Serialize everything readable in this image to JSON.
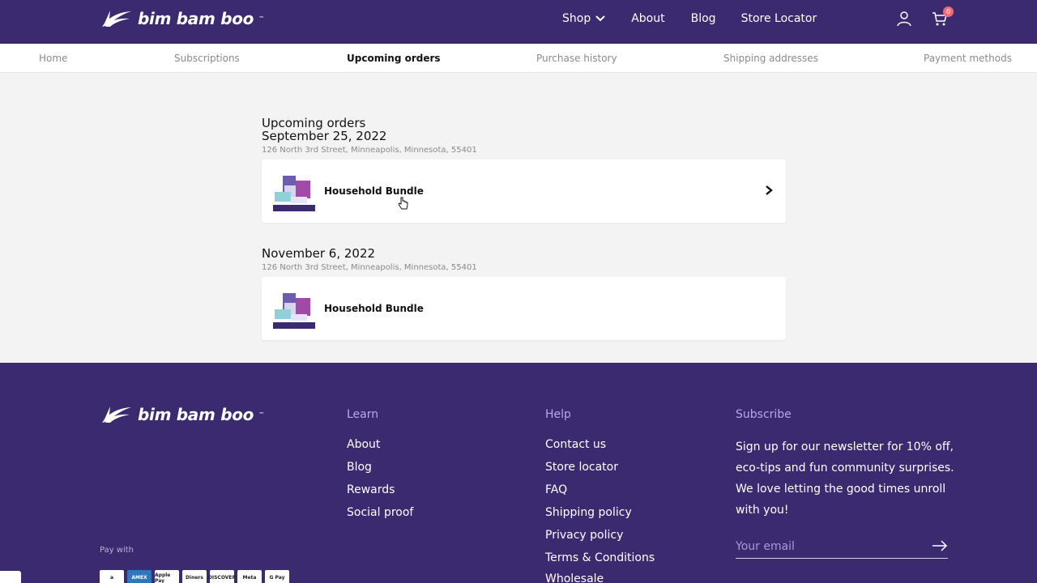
{
  "brand": {
    "name": "bim bam boo",
    "trademark": "™"
  },
  "header": {
    "nav": [
      {
        "label": "Shop",
        "has_dropdown": true
      },
      {
        "label": "About"
      },
      {
        "label": "Blog"
      },
      {
        "label": "Store Locator"
      }
    ],
    "cart_count": "0"
  },
  "subnav": {
    "items": [
      "Home",
      "Subscriptions",
      "Upcoming orders",
      "Purchase history",
      "Shipping addresses",
      "Payment methods"
    ],
    "active": "Upcoming orders"
  },
  "main": {
    "title": "Upcoming orders",
    "orders": [
      {
        "date": "September 25, 2022",
        "address": "126 North 3rd Street, Minneapolis, Minnesota, 55401",
        "product": "Household Bundle"
      },
      {
        "date": "November 6, 2022",
        "address": "126 North 3rd Street, Minneapolis, Minnesota, 55401",
        "product": "Household Bundle"
      }
    ]
  },
  "footer": {
    "learn": {
      "title": "Learn",
      "links": [
        "About",
        "Blog",
        "Rewards",
        "Social proof"
      ]
    },
    "help": {
      "title": "Help",
      "links": [
        "Contact us",
        "Store locator",
        "FAQ",
        "Shipping policy",
        "Privacy policy",
        "Terms & Conditions",
        "Wholesale"
      ]
    },
    "subscribe": {
      "title": "Subscribe",
      "text": "Sign up for our newsletter for 10% off, eco-tips and fun community surprises. We love letting the good times unroll with you!",
      "email_placeholder": "Your email"
    },
    "pay_with": "Pay with",
    "payment_methods": [
      "a",
      "AMEX",
      "Apple Pay",
      "Diners",
      "DISCOVER",
      "Meta",
      "G Pay"
    ]
  },
  "colors": {
    "brand_purple": "#3b2a6f",
    "footer_heading": "#b9a6f0",
    "badge": "#ef6c7a"
  }
}
